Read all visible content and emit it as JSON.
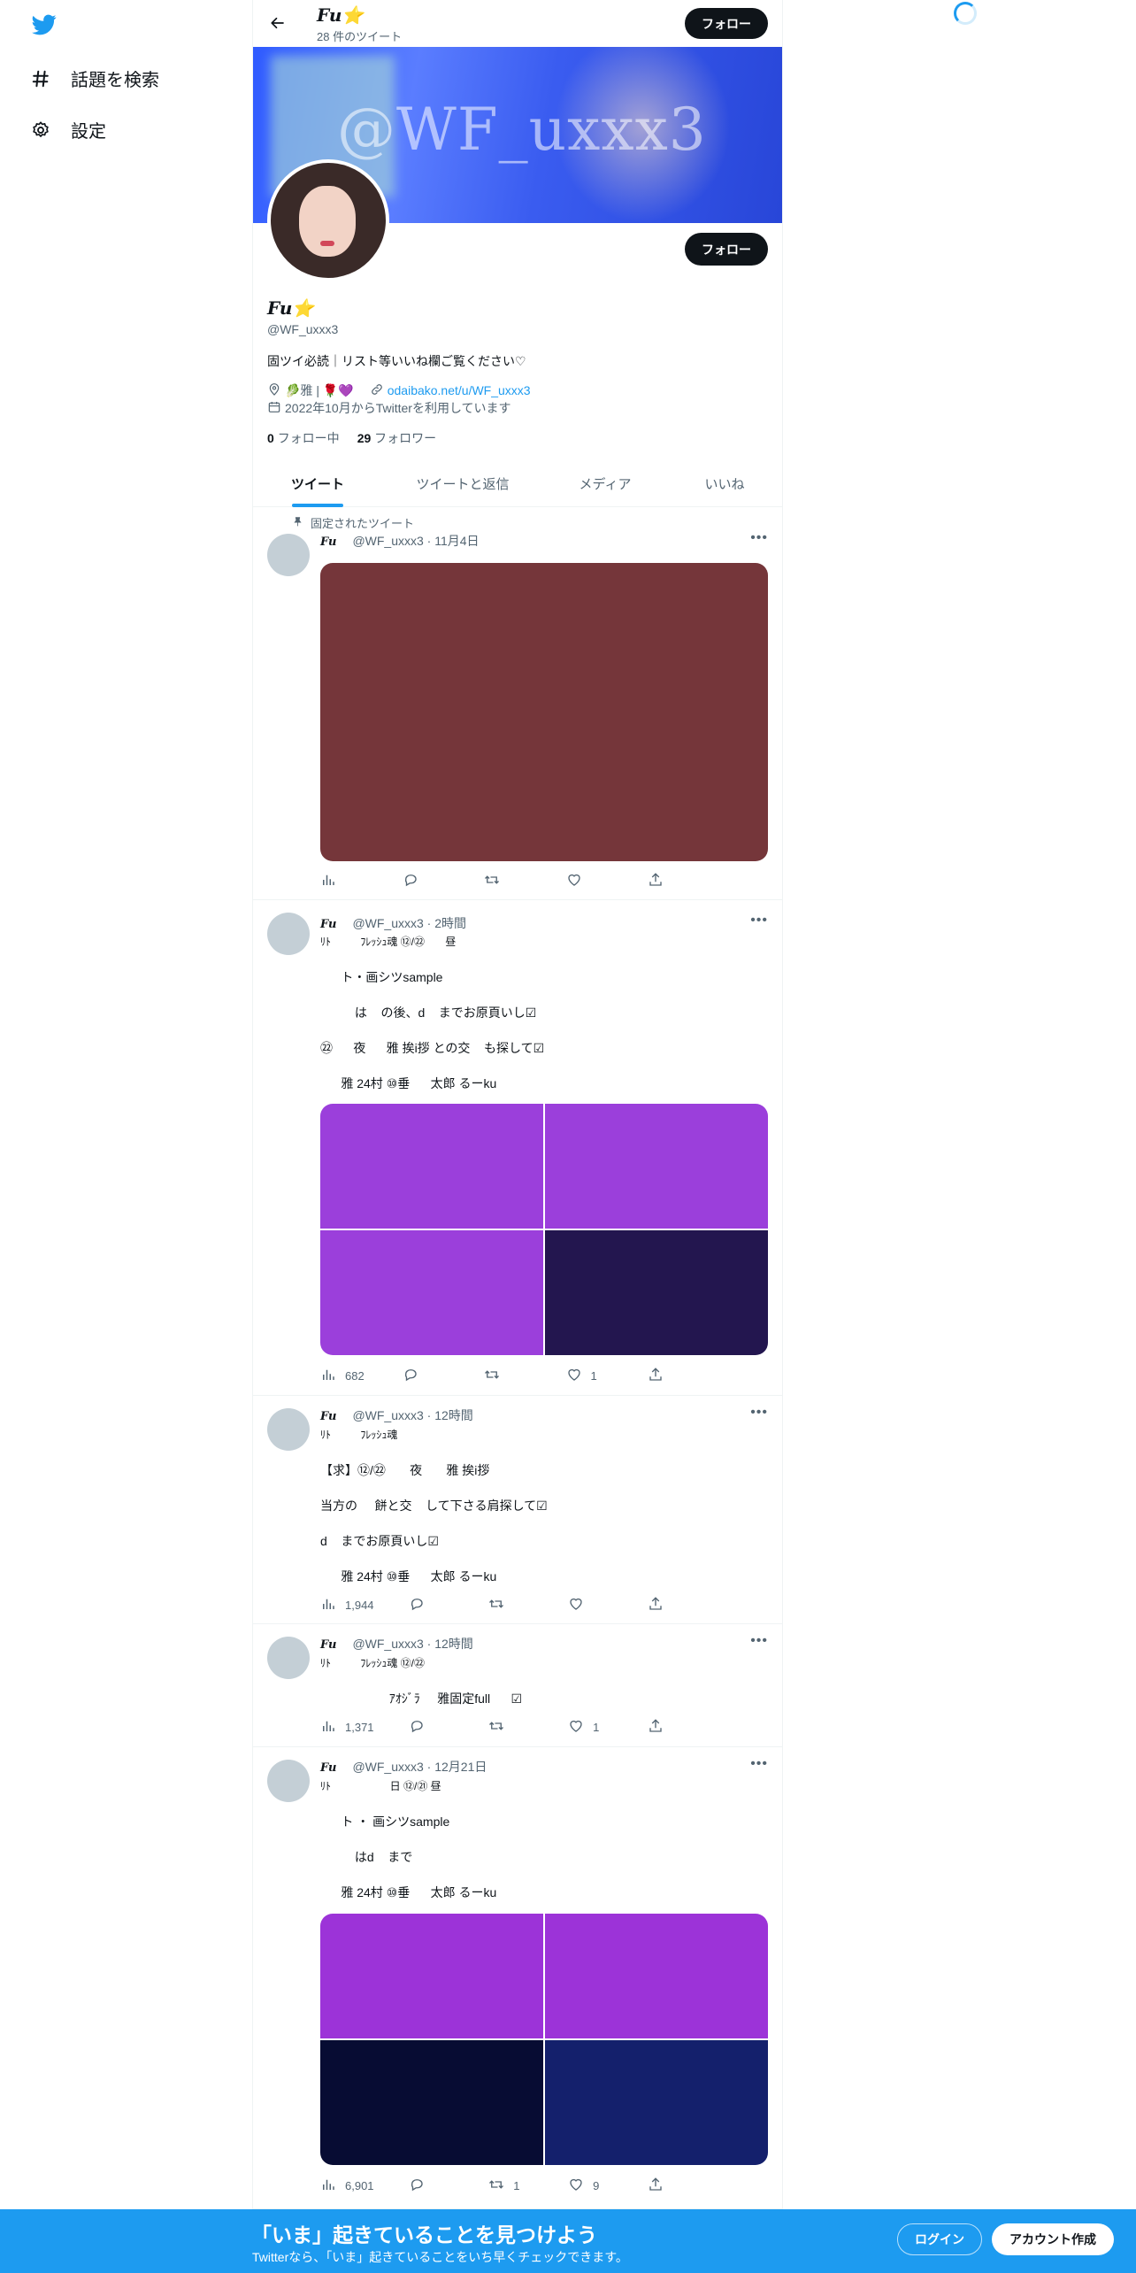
{
  "sidebar": {
    "items": [
      {
        "label": "話題を検索",
        "icon": "hashtag-icon"
      },
      {
        "label": "設定",
        "icon": "gear-icon"
      }
    ]
  },
  "header": {
    "name": "Fu⭐",
    "tweet_count": "28 件のツイート",
    "follow_label": "フォロー"
  },
  "banner": {
    "watermark": "@WF_uxxx3"
  },
  "profile": {
    "name": "Fu⭐",
    "handle": "@WF_uxxx3",
    "follow_label": "フォロー",
    "bio": "固ツイ必読｜リスト等いいね欄ご覧ください♡",
    "location": "🥬雅  |  🌹💜",
    "link": "odaibako.net/u/WF_uxxx3",
    "joined": "2022年10月からTwitterを利用しています",
    "following_count": "0",
    "following_label": "フォロー中",
    "followers_count": "29",
    "followers_label": "フォロワー"
  },
  "tabs": [
    "ツイート",
    "ツイートと返信",
    "メディア",
    "いいね"
  ],
  "pinned_label": "固定されたツイート",
  "tweets": [
    {
      "name": "Fu",
      "meta": "@WF_uxxx3 · 11月4日",
      "media_colors": [
        "#75363a"
      ]
    },
    {
      "name": "Fu",
      "meta": "@WF_uxxx3 · 2時間",
      "lines": [
        "ﾘﾄ          ﾌﾚｯｼｭ魂 ⑫/㉒       昼",
        "      ト・画シツsample",
        "          は    の後、d    までお原頁いし☑",
        "㉒      夜      雅 挨i拶 との交    も探して☑",
        "      雅 24村 ⑩垂      太郎 るーku"
      ],
      "media_colors": [
        "#9b3fdb",
        "#9b3fdb",
        "#9b3fdb",
        "#23164f"
      ],
      "views": "682",
      "replies": "",
      "retweets": "",
      "likes": "1"
    },
    {
      "name": "Fu",
      "meta": "@WF_uxxx3 · 12時間",
      "lines": [
        "ﾘﾄ          ﾌﾚｯｼｭ魂",
        "【求】⑫/㉒       夜       雅 挨i拶",
        "当方の     餅と交    して下さる肩探して☑",
        "d    までお原頁いし☑",
        "      雅 24村 ⑩垂      太郎 るーku"
      ],
      "views": "1,944",
      "replies": "",
      "retweets": "",
      "likes": ""
    },
    {
      "name": "Fu",
      "meta": "@WF_uxxx3 · 12時間",
      "lines": [
        "ﾘﾄ          ﾌﾚｯｼｭ魂 ⑫/㉒",
        "                    ｱｵｼﾞﾗ     雅固定full      ☑"
      ],
      "views": "1,371",
      "replies": "",
      "retweets": "",
      "likes": "1"
    },
    {
      "name": "Fu",
      "meta": "@WF_uxxx3 · 12月21日",
      "lines": [
        "ﾘﾄ                    日 ⑫/㉑ 昼",
        "      ト ・ 画シツsample",
        "          はd    まで",
        "      雅 24村 ⑩垂      太郎 るーku"
      ],
      "media_colors": [
        "#9c33d8",
        "#9c33d8",
        "#070c33",
        "#14206c"
      ],
      "views": "6,901",
      "replies": "",
      "retweets": "1",
      "likes": "9"
    }
  ],
  "bottombar": {
    "headline": "「いま」起きていることを見つけよう",
    "sub": "Twitterなら、「いま」起きていることをいち早くチェックできます。",
    "login": "ログイン",
    "signup": "アカウント作成"
  },
  "colors": {
    "accent": "#1d9bf0",
    "text": "#0f1419",
    "muted": "#536471"
  }
}
